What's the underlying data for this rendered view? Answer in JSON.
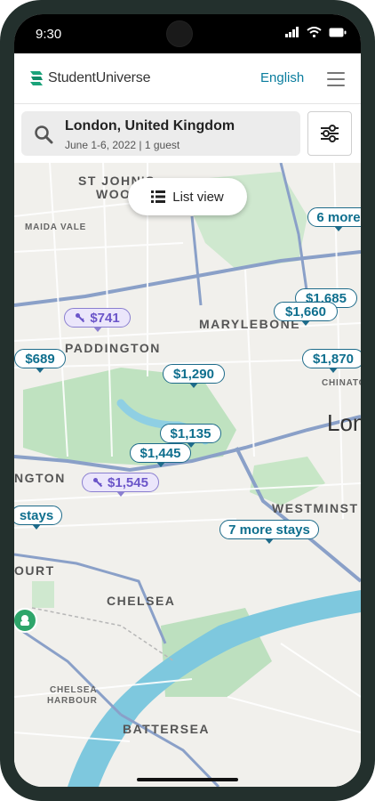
{
  "status": {
    "time": "9:30"
  },
  "header": {
    "brand": "StudentUniverse",
    "language": "English"
  },
  "search": {
    "location": "London, United Kingdom",
    "dates": "June 1-6, 2022",
    "separator": "|",
    "guests": "1 guest"
  },
  "map": {
    "list_view_label": "List view",
    "labels": {
      "st_johns_1": "ST JOHN'S",
      "st_johns_2": "WOOD",
      "maida_vale": "MAIDA VALE",
      "marylebone": "MARYLEBONE",
      "paddington": "PADDINGTON",
      "chinatown": "CHINATO",
      "london": "Lon",
      "kensington": "NGTON",
      "westminster": "WESTMINST",
      "earls_court": "OURT",
      "chelsea": "CHELSEA",
      "chelsea_harbour_1": "CHELSEA",
      "chelsea_harbour_2": "HARBOUR",
      "battersea": "BATTERSEA"
    },
    "pins": {
      "more_top": "6 more",
      "p1685": "$1,685",
      "p1660": "$1,660",
      "p741": "$741",
      "p689": "$689",
      "p1870": "$1,870",
      "p1290": "$1,290",
      "p1135": "$1,135",
      "p1445": "$1,445",
      "p1545": "$1,545",
      "stays_left": "stays",
      "more_stays": "7 more stays"
    }
  },
  "colors": {
    "accent": "#0a7d9e",
    "water": "#7ec8de",
    "park": "#bfe2c0",
    "deal": "#6b55c9"
  }
}
